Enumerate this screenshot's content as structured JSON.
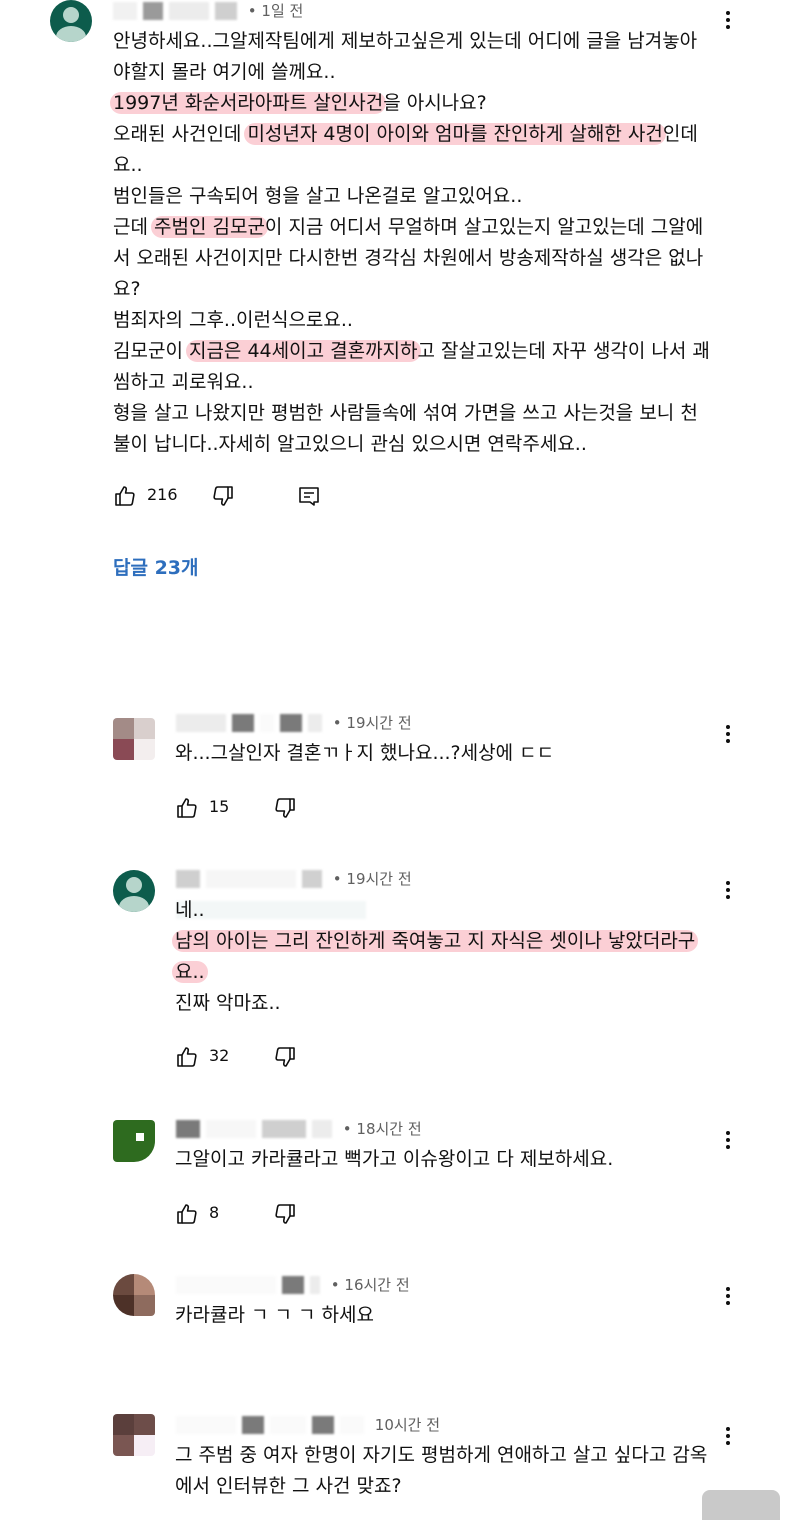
{
  "main_comment": {
    "time": "• 1일 전",
    "lines": [
      [
        {
          "t": "안녕하세요..그알제작팀에게 제보하고싶은게 있는데 어디에 글을 남겨놓아"
        }
      ],
      [
        {
          "t": "야할지 몰라 여기에 쓸께요.."
        }
      ],
      [
        {
          "t": "1997년 화순서라아파트 살인사건",
          "hl": true
        },
        {
          "t": "을 아시나요?"
        }
      ],
      [
        {
          "t": "오래된 사건인데 "
        },
        {
          "t": "미성년자 4명이 아이와 엄마를 잔인하게 살해한 사건",
          "hl": true
        },
        {
          "t": "인데"
        }
      ],
      [
        {
          "t": "요.."
        }
      ],
      [
        {
          "t": "범인들은 구속되어 형을 살고 나온걸로 알고있어요.."
        }
      ],
      [
        {
          "t": "근데 "
        },
        {
          "t": "주범인 김모군",
          "hl": true
        },
        {
          "t": "이 지금 어디서 무얼하며 살고있는지 알고있는데 그알에"
        }
      ],
      [
        {
          "t": "서 오래된 사건이지만 다시한번 경각심 차원에서 방송제작하실 생각은 없나"
        }
      ],
      [
        {
          "t": "요?"
        }
      ],
      [
        {
          "t": "범죄자의 그후..이런식으로요.."
        }
      ],
      [
        {
          "t": "김모군이 "
        },
        {
          "t": "지금은 44세이고 결혼까지하",
          "hl": true
        },
        {
          "t": "고 잘살고있는데 자꾸 생각이 나서 괘"
        }
      ],
      [
        {
          "t": "씸하고 괴로워요.."
        }
      ],
      [
        {
          "t": "형을 살고 나왔지만 평범한 사람들속에 섞여 가면을 쓰고 사는것을 보니 천"
        }
      ],
      [
        {
          "t": "불이 납니다..자세히 알고있으니 관심 있으시면 연락주세요.."
        }
      ]
    ],
    "likes": "216",
    "replies_label": "답글 23개"
  },
  "replies": [
    {
      "time": "• 19시간 전",
      "lines": [
        [
          {
            "t": "와...그살인자 결혼ㄲㅏ지 했나요...?세상에 ㄷㄷ"
          }
        ]
      ],
      "likes": "15"
    },
    {
      "time": "• 19시간 전",
      "lines": [
        [
          {
            "t": "네.."
          }
        ],
        [
          {
            "t": "남의 아이는 그리 잔인하게 죽여놓고 지 자식은 셋이나 낳았더라구",
            "hl": true
          }
        ],
        [
          {
            "t": "요..",
            "hl": true
          }
        ],
        [
          {
            "t": "진짜 악마죠.."
          }
        ]
      ],
      "likes": "32"
    },
    {
      "time": "• 18시간 전",
      "lines": [
        [
          {
            "t": "그알이고 카라큘라고 뻑가고 이슈왕이고 다 제보하세요."
          }
        ]
      ],
      "likes": "8"
    },
    {
      "time": "• 16시간 전",
      "lines": [
        [
          {
            "t": "카라큘라 ㄱ ㄱ ㄱ 하세요"
          }
        ]
      ],
      "likes": ""
    },
    {
      "time": "10시간 전",
      "lines": [
        [
          {
            "t": "그 주범 중 여자 한명이 자기도 평범하게 연애하고 살고 싶다고 감옥"
          }
        ],
        [
          {
            "t": "에서 인터뷰한 그 사건 맞죠?"
          }
        ]
      ],
      "likes": ""
    }
  ],
  "icons": {
    "like": "thumbs-up-icon",
    "dislike": "thumbs-down-icon",
    "reply": "comment-reply-icon",
    "menu": "more-vertical-icon"
  },
  "colors": {
    "highlight": "#f7a7b2",
    "link": "#2d6ebd",
    "text": "#111111",
    "meta": "#606060"
  }
}
